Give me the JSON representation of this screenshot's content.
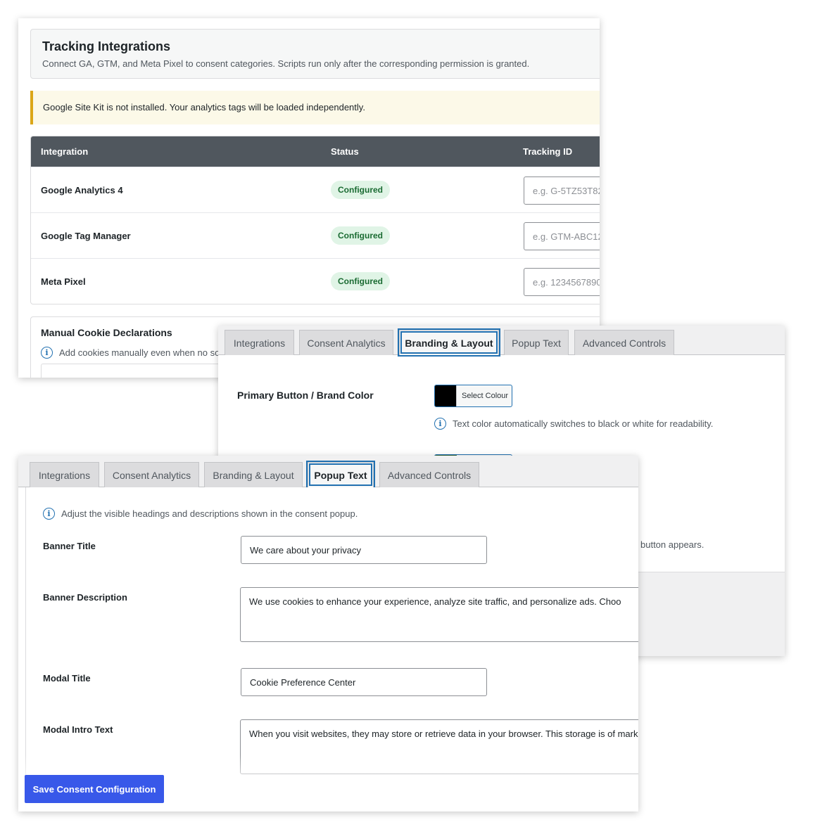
{
  "tracking": {
    "title": "Tracking Integrations",
    "subtitle": "Connect GA, GTM, and Meta Pixel to consent categories. Scripts run only after the corresponding permission is granted.",
    "notice": "Google Site Kit is not installed. Your analytics tags will be loaded independently.",
    "columns": [
      "Integration",
      "Status",
      "Tracking ID"
    ],
    "rows": [
      {
        "name": "Google Analytics 4",
        "status": "Configured",
        "placeholder": "e.g. G-5TZ53T82"
      },
      {
        "name": "Google Tag Manager",
        "status": "Configured",
        "placeholder": "e.g. GTM-ABC12"
      },
      {
        "name": "Meta Pixel",
        "status": "Configured",
        "placeholder": "e.g. 1234567890"
      }
    ],
    "manual_title": "Manual Cookie Declarations",
    "manual_hint": "Add cookies manually even when no so"
  },
  "tabs": [
    "Integrations",
    "Consent Analytics",
    "Branding & Layout",
    "Popup Text",
    "Advanced Controls"
  ],
  "branding": {
    "primary_label": "Primary Button / Brand Color",
    "select_colour": "Select Colour",
    "primary_color": "#000000",
    "hint": "Text color automatically switches to black or white for readability.",
    "hint2": "button appears."
  },
  "popup": {
    "hint": "Adjust the visible headings and descriptions shown in the consent popup.",
    "banner_title_label": "Banner Title",
    "banner_title_value": "We care about your privacy",
    "banner_desc_label": "Banner Description",
    "banner_desc_value": "We use cookies to enhance your experience, analyze site traffic, and personalize ads. Choo",
    "modal_title_label": "Modal Title",
    "modal_title_value": "Cookie Preference Center",
    "modal_intro_label": "Modal Intro Text",
    "modal_intro_value": "When you visit websites, they may store or retrieve data in your browser. This storage is of\nmarketing, analytics, and personalization."
  },
  "save_label": "Save Consent Configuration",
  "colors": {
    "accent": "#2271b1",
    "save": "#3858e9",
    "header": "#50575e",
    "badge_bg": "#e0f4e6",
    "notice_border": "#dba617"
  }
}
